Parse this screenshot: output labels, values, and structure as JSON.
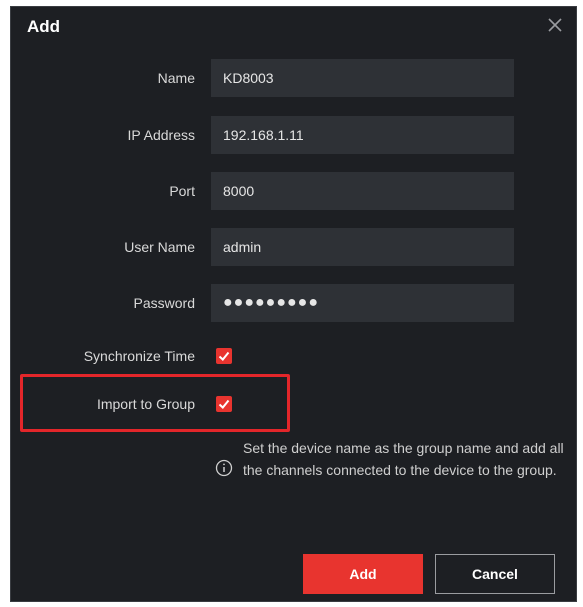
{
  "dialog": {
    "title": "Add",
    "close_icon": "close-icon"
  },
  "form": {
    "name": {
      "label": "Name",
      "value": "KD8003"
    },
    "ip_address": {
      "label": "IP Address",
      "value": "192.168.1.11"
    },
    "port": {
      "label": "Port",
      "value": "8000"
    },
    "user_name": {
      "label": "User Name",
      "value": "admin"
    },
    "password": {
      "label": "Password",
      "value": "●●●●●●●●●"
    },
    "synchronize_time": {
      "label": "Synchronize Time",
      "checked": true
    },
    "import_to_group": {
      "label": "Import to Group",
      "checked": true
    },
    "hint": "Set the device name as the group name and add all the channels connected to the device to the group."
  },
  "buttons": {
    "add": "Add",
    "cancel": "Cancel"
  },
  "colors": {
    "accent": "#e8342f",
    "highlight": "#e3262a",
    "background": "#1d1f23",
    "field": "#2e3136"
  }
}
